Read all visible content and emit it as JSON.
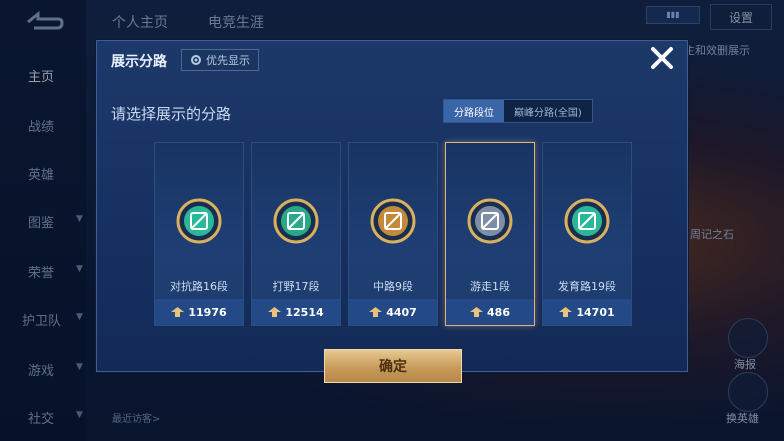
{
  "background": {
    "top_tabs": [
      "个人主页",
      "电竞生涯"
    ],
    "settings_label": "设置",
    "right_texts": [
      "主和效删展示",
      "周记之石"
    ],
    "right_buttons": [
      "海报",
      "换英雄"
    ],
    "visitors_label": "最近访客>",
    "nav": {
      "items": [
        {
          "label": "主页",
          "active": true
        },
        {
          "label": "战绩",
          "active": false
        },
        {
          "label": "英雄",
          "active": false
        },
        {
          "label": "图鉴",
          "active": false
        },
        {
          "label": "荣誉",
          "active": false
        },
        {
          "label": "护卫队",
          "active": false
        },
        {
          "label": "游戏",
          "active": false
        },
        {
          "label": "社交",
          "active": false
        }
      ]
    }
  },
  "modal": {
    "title": "展示分路",
    "priority_label": "优先显示",
    "subtitle": "请选择展示的分路",
    "toggle": {
      "active": "分路段位",
      "inactive": "巅峰分路(全国)"
    },
    "cards": [
      {
        "role": "对抗路16段",
        "score": "11976",
        "icon": "clash-lane-emblem-icon",
        "color": "#2bb89a",
        "selected": false
      },
      {
        "role": "打野17段",
        "score": "12514",
        "icon": "jungle-dragon-emblem-icon",
        "color": "#2aa98a",
        "selected": false
      },
      {
        "role": "中路9段",
        "score": "4407",
        "icon": "mid-lane-emblem-icon",
        "color": "#c28a3a",
        "selected": false
      },
      {
        "role": "游走1段",
        "score": "486",
        "icon": "roam-wings-emblem-icon",
        "color": "#7d8fa8",
        "selected": true
      },
      {
        "role": "发育路19段",
        "score": "14701",
        "icon": "farm-lane-emblem-icon",
        "color": "#2bb89a",
        "selected": false
      }
    ],
    "confirm_label": "确定"
  }
}
